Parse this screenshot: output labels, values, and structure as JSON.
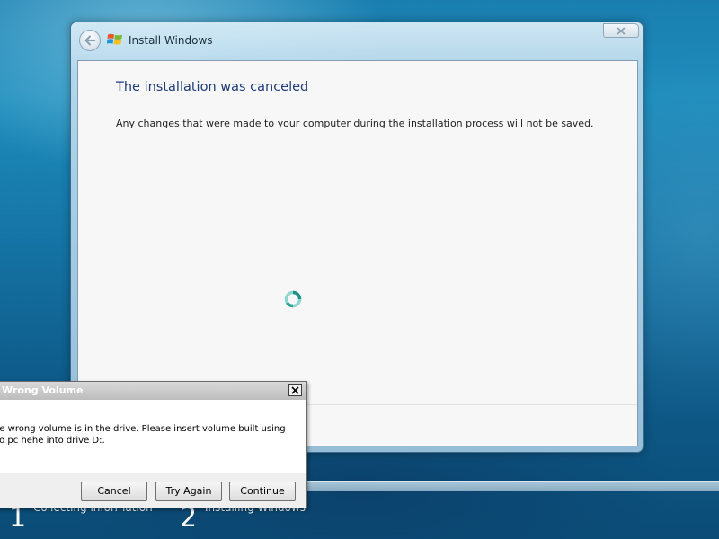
{
  "colors": {
    "heading": "#1e3c78",
    "desktop": "#1574a5",
    "dialog_title_bar": "#c9c9c9"
  },
  "installer": {
    "window_title": "Install Windows",
    "heading": "The installation was canceled",
    "message": "Any changes that were made to your computer during the installation process will not be saved.",
    "back_icon": "back-arrow-icon",
    "logo_icon": "windows-logo-icon",
    "close_icon": "close-icon",
    "spinner_icon": "busy-spinner-icon"
  },
  "steps": [
    {
      "number": "1",
      "label": "Collecting information"
    },
    {
      "number": "2",
      "label": "Installing Windows"
    }
  ],
  "dialog": {
    "title": "Wrong Volume",
    "message_line1": "he wrong volume is in the drive. Please insert volume built using",
    "message_line2": "oo pc hehe into drive D:.",
    "buttons": {
      "cancel": "Cancel",
      "try_again": "Try Again",
      "continue": "Continue"
    }
  }
}
